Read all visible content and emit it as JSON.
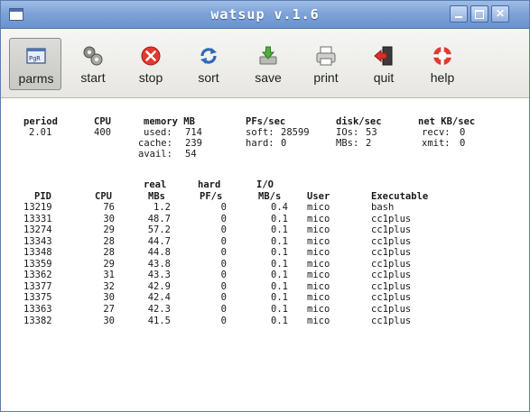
{
  "window": {
    "title": "watsup v.1.6"
  },
  "toolbar": [
    {
      "label": "parms",
      "icon": "parms-icon",
      "active": true
    },
    {
      "label": "start",
      "icon": "start-icon"
    },
    {
      "label": "stop",
      "icon": "stop-icon"
    },
    {
      "label": "sort",
      "icon": "sort-icon"
    },
    {
      "label": "save",
      "icon": "save-icon"
    },
    {
      "label": "print",
      "icon": "print-icon"
    },
    {
      "label": "quit",
      "icon": "quit-icon"
    },
    {
      "label": "help",
      "icon": "help-icon"
    }
  ],
  "stats": {
    "period": {
      "label": "period",
      "value": "2.01"
    },
    "cpu": {
      "label": "CPU",
      "value": "400"
    },
    "memory": {
      "label": "memory MB",
      "used_label": "used:",
      "used": "714",
      "cache_label": "cache:",
      "cache": "239",
      "avail_label": "avail:",
      "avail": "54"
    },
    "pfs": {
      "label": "PFs/sec",
      "soft_label": "soft:",
      "soft": "28599",
      "hard_label": "hard:",
      "hard": "0"
    },
    "disk": {
      "label": "disk/sec",
      "ios_label": "IOs:",
      "ios": "53",
      "mbs_label": "MBs:",
      "mbs": "2"
    },
    "net": {
      "label": "net KB/sec",
      "recv_label": "recv:",
      "recv": "0",
      "xmit_label": "xmit:",
      "xmit": "0"
    }
  },
  "table": {
    "headers_top": {
      "real": "real",
      "hard": "hard",
      "io": "I/O"
    },
    "headers": {
      "pid": "PID",
      "cpu": "CPU",
      "mbs": "MBs",
      "pfs": "PF/s",
      "io": "MB/s",
      "user": "User",
      "exe": "Executable"
    },
    "rows": [
      {
        "pid": "13219",
        "cpu": "76",
        "mbs": "1.2",
        "pfs": "0",
        "io": "0.4",
        "user": "mico",
        "exe": "bash"
      },
      {
        "pid": "13331",
        "cpu": "30",
        "mbs": "48.7",
        "pfs": "0",
        "io": "0.1",
        "user": "mico",
        "exe": "cc1plus"
      },
      {
        "pid": "13274",
        "cpu": "29",
        "mbs": "57.2",
        "pfs": "0",
        "io": "0.1",
        "user": "mico",
        "exe": "cc1plus"
      },
      {
        "pid": "13343",
        "cpu": "28",
        "mbs": "44.7",
        "pfs": "0",
        "io": "0.1",
        "user": "mico",
        "exe": "cc1plus"
      },
      {
        "pid": "13348",
        "cpu": "28",
        "mbs": "44.8",
        "pfs": "0",
        "io": "0.1",
        "user": "mico",
        "exe": "cc1plus"
      },
      {
        "pid": "13359",
        "cpu": "29",
        "mbs": "43.8",
        "pfs": "0",
        "io": "0.1",
        "user": "mico",
        "exe": "cc1plus"
      },
      {
        "pid": "13362",
        "cpu": "31",
        "mbs": "43.3",
        "pfs": "0",
        "io": "0.1",
        "user": "mico",
        "exe": "cc1plus"
      },
      {
        "pid": "13377",
        "cpu": "32",
        "mbs": "42.9",
        "pfs": "0",
        "io": "0.1",
        "user": "mico",
        "exe": "cc1plus"
      },
      {
        "pid": "13375",
        "cpu": "30",
        "mbs": "42.4",
        "pfs": "0",
        "io": "0.1",
        "user": "mico",
        "exe": "cc1plus"
      },
      {
        "pid": "13363",
        "cpu": "27",
        "mbs": "42.3",
        "pfs": "0",
        "io": "0.1",
        "user": "mico",
        "exe": "cc1plus"
      },
      {
        "pid": "13382",
        "cpu": "30",
        "mbs": "41.5",
        "pfs": "0",
        "io": "0.1",
        "user": "mico",
        "exe": "cc1plus"
      }
    ]
  }
}
